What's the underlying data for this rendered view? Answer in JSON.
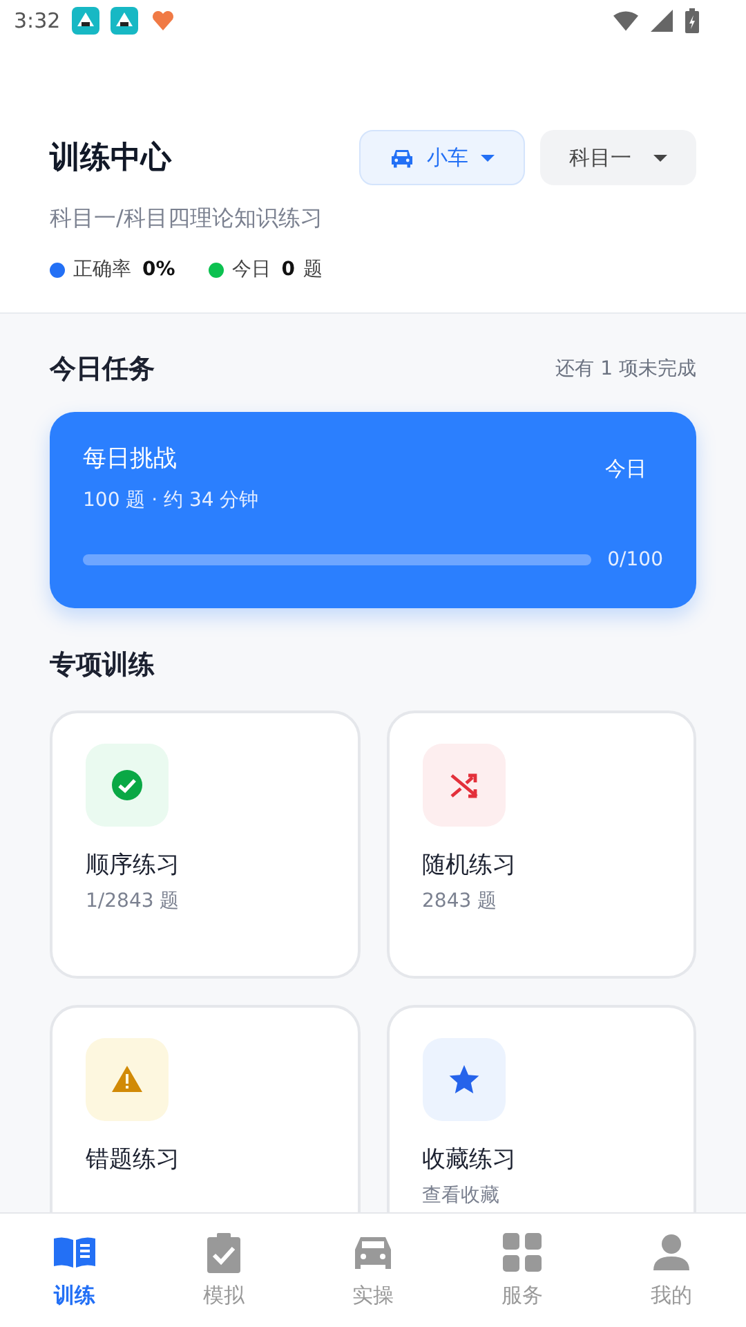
{
  "status_bar": {
    "time": "3:32"
  },
  "header": {
    "title": "训练中心",
    "vehicle_button": {
      "label": "小车"
    },
    "subject_button": {
      "label": "科目一"
    },
    "subtitle": "科目一/科目四理论知识练习",
    "stats": [
      {
        "label": "正确率",
        "value": "0%",
        "color": "#2370f5"
      },
      {
        "label": "今日",
        "value": "0",
        "unit": "题",
        "color": "#0cc150"
      }
    ]
  },
  "today_tasks": {
    "title": "今日任务",
    "remaining": "还有 1 项未完成",
    "challenge": {
      "title": "每日挑战",
      "detail": "100 题 · 约 34 分钟",
      "badge": "今日",
      "level": 0,
      "progress": "0/100"
    }
  },
  "special_training": {
    "title": "专项训练",
    "cards": [
      {
        "kind": "check",
        "title": "顺序练习",
        "subtitle": "1/2843 题",
        "color": "#0aa845"
      },
      {
        "kind": "shuffle",
        "title": "随机练习",
        "subtitle": "2843 题",
        "color": "#e3303b"
      },
      {
        "kind": "warning",
        "title": "错题练习",
        "color": "#d18a06"
      },
      {
        "kind": "star",
        "title": "收藏练习",
        "subtitle": "查看收藏",
        "color": "#2563eb"
      }
    ]
  },
  "bottom_nav": [
    {
      "kind": "book",
      "label": "训练",
      "selected": true
    },
    {
      "kind": "clipboard",
      "label": "模拟",
      "selected": false
    },
    {
      "kind": "car",
      "label": "实操",
      "selected": false
    },
    {
      "kind": "grid",
      "label": "服务",
      "selected": false
    },
    {
      "kind": "person",
      "label": "我的",
      "selected": false
    }
  ]
}
